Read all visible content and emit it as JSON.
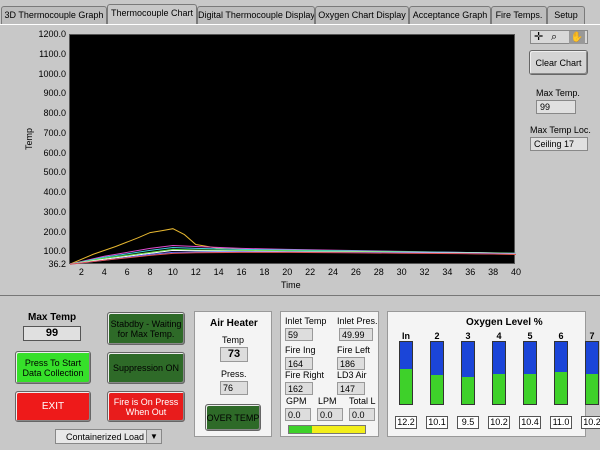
{
  "tabs": [
    "3D Thermocouple Graph",
    "Thermocouple Chart",
    "Digital Thermocouple Display",
    "Oxygen Chart Display",
    "Acceptance Graph",
    "Fire Temps.",
    "Setup"
  ],
  "active_tab": "Thermocouple Chart",
  "chart_data": {
    "type": "line",
    "ylabel": "Temp",
    "xlabel": "Time",
    "ylim": [
      36.2,
      1200.0
    ],
    "xlim": [
      1,
      40
    ],
    "y_ticks": [
      "1200.0",
      "1100.0",
      "1000.0",
      "900.0",
      "800.0",
      "700.0",
      "600.0",
      "500.0",
      "400.0",
      "300.0",
      "200.0",
      "100.0",
      "36.2"
    ],
    "x_ticks": [
      "2",
      "4",
      "6",
      "8",
      "10",
      "12",
      "14",
      "16",
      "18",
      "20",
      "22",
      "24",
      "26",
      "28",
      "30",
      "32",
      "34",
      "36",
      "38",
      "40"
    ],
    "series": [
      {
        "color": "#e8b830",
        "x": [
          1,
          3,
          5,
          7,
          8,
          9,
          10,
          11,
          12,
          14,
          16,
          20,
          25,
          30,
          35,
          40
        ],
        "y": [
          40,
          90,
          130,
          175,
          200,
          210,
          220,
          190,
          140,
          120,
          115,
          110,
          105,
          100,
          95,
          90
        ]
      },
      {
        "color": "#e04cd0",
        "x": [
          1,
          4,
          8,
          10,
          12,
          16,
          20,
          25,
          30,
          35,
          40
        ],
        "y": [
          40,
          80,
          120,
          135,
          130,
          120,
          115,
          110,
          105,
          100,
          95
        ]
      },
      {
        "color": "#40d0e0",
        "x": [
          1,
          4,
          8,
          10,
          12,
          16,
          20,
          25,
          30,
          35,
          40
        ],
        "y": [
          40,
          75,
          110,
          125,
          120,
          115,
          112,
          108,
          104,
          100,
          96
        ]
      },
      {
        "color": "#60e040",
        "x": [
          1,
          4,
          8,
          10,
          12,
          16,
          20,
          25,
          30,
          35,
          40
        ],
        "y": [
          40,
          70,
          100,
          115,
          112,
          110,
          108,
          105,
          102,
          99,
          95
        ]
      },
      {
        "color": "#ffffff",
        "x": [
          1,
          4,
          8,
          10,
          12,
          16,
          20,
          25,
          30,
          35,
          40
        ],
        "y": [
          40,
          65,
          95,
          110,
          108,
          106,
          104,
          102,
          100,
          98,
          94
        ]
      },
      {
        "color": "#6070ff",
        "x": [
          1,
          4,
          8,
          10,
          12,
          16,
          20,
          25,
          30,
          35,
          40
        ],
        "y": [
          40,
          60,
          90,
          100,
          102,
          103,
          102,
          100,
          98,
          96,
          92
        ]
      },
      {
        "color": "#e05050",
        "x": [
          1,
          4,
          8,
          10,
          12,
          16,
          20,
          25,
          30,
          35,
          40
        ],
        "y": [
          40,
          60,
          85,
          95,
          98,
          100,
          100,
          98,
          96,
          94,
          90
        ]
      }
    ]
  },
  "chart_tools": {
    "label": "Clear Chart",
    "max_temp_label": "Max Temp.",
    "max_temp_value": "99",
    "max_temp_loc_label": "Max Temp Loc.",
    "max_temp_loc_value": "Ceiling 17"
  },
  "bottom": {
    "max_temp_label": "Max Temp",
    "max_temp_value": "99",
    "start_button": "Press To Start Data Collection",
    "exit_button": "EXIT",
    "standby_button": "Stabdby - Waiting for Max Temp.",
    "suppression_button": "Suppression ON",
    "fire_button": "Fire is On Press When Out",
    "load_select": "Containerized Load"
  },
  "air_heater": {
    "title": "Air Heater",
    "temp_label": "Temp",
    "temp_value": "73",
    "press_label": "Press.",
    "press_value": "76",
    "over_temp": "OVER TEMP"
  },
  "readings": {
    "inlet_temp_label": "Inlet Temp",
    "inlet_temp_value": "59",
    "inlet_pres_label": "Inlet Pres.",
    "inlet_pres_value": "49.99",
    "fire_ing_label": "Fire Ing",
    "fire_ing_value": "164",
    "fire_left_label": "Fire Left",
    "fire_left_value": "186",
    "fire_right_label": "Fire Right",
    "fire_right_value": "162",
    "ld3_air_label": "LD3 Air",
    "ld3_air_value": "147",
    "gpm_label": "GPM",
    "gpm_value": "0.0",
    "lpm_label": "LPM",
    "lpm_value": "0.0",
    "total_label": "Total L",
    "total_value": "0.0",
    "progress": 0.3
  },
  "oxygen": {
    "title": "Oxygen Level %",
    "channels": [
      {
        "label": "In",
        "value": "12.2",
        "level": 0.56
      },
      {
        "label": "2",
        "value": "10.1",
        "level": 0.47
      },
      {
        "label": "3",
        "value": "9.5",
        "level": 0.43
      },
      {
        "label": "4",
        "value": "10.2",
        "level": 0.48
      },
      {
        "label": "5",
        "value": "10.4",
        "level": 0.49
      },
      {
        "label": "6",
        "value": "11.0",
        "level": 0.52
      },
      {
        "label": "7",
        "value": "10.2",
        "level": 0.48
      }
    ]
  }
}
